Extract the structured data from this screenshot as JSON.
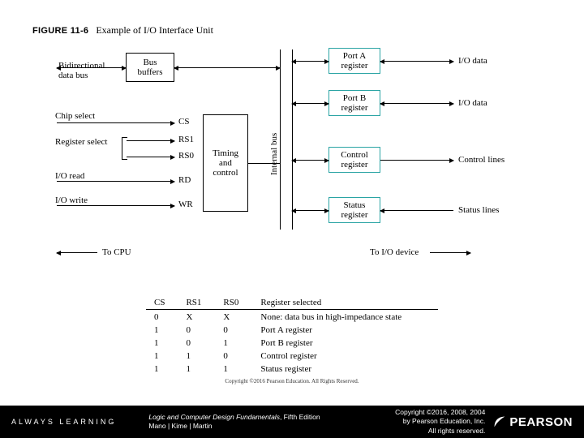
{
  "figure": {
    "number": "FIGURE 11-6",
    "caption": "Example of I/O Interface Unit"
  },
  "blocks": {
    "data_bus": "Bidirectional\ndata bus",
    "bus_buffers": "Bus\nbuffers",
    "timing": "Timing\nand\ncontrol",
    "internal_bus": "Internal bus",
    "port_a": "Port A\nregister",
    "port_b": "Port B\nregister",
    "control_reg": "Control\nregister",
    "status_reg": "Status\nregister"
  },
  "signals": {
    "chip_select": "Chip select",
    "register_select": "Register select",
    "io_read": "I/O read",
    "io_write": "I/O write",
    "cs": "CS",
    "rs1": "RS1",
    "rs0": "RS0",
    "rd": "RD",
    "wr": "WR",
    "io_data_a": "I/O data",
    "io_data_b": "I/O data",
    "control_lines": "Control lines",
    "status_lines": "Status lines",
    "to_cpu": "To CPU",
    "to_io": "To I/O device"
  },
  "table": {
    "headers": [
      "CS",
      "RS1",
      "RS0",
      "Register selected"
    ],
    "rows": [
      [
        "0",
        "X",
        "X",
        "None: data bus in high-impedance state"
      ],
      [
        "1",
        "0",
        "0",
        "Port A register"
      ],
      [
        "1",
        "0",
        "1",
        "Port B register"
      ],
      [
        "1",
        "1",
        "0",
        "Control register"
      ],
      [
        "1",
        "1",
        "1",
        "Status register"
      ]
    ]
  },
  "inner_copyright": "Copyright ©2016 Pearson Education. All Rights Reserved.",
  "footer": {
    "always": "ALWAYS LEARNING",
    "book_title": "Logic and Computer Design Fundamentals",
    "book_edition": ", Fifth Edition",
    "authors": "Mano | Kime | Martin",
    "copyright": "Copyright ©2016, 2008, 2004\nby Pearson Education, Inc.\nAll rights reserved.",
    "brand": "PEARSON"
  }
}
